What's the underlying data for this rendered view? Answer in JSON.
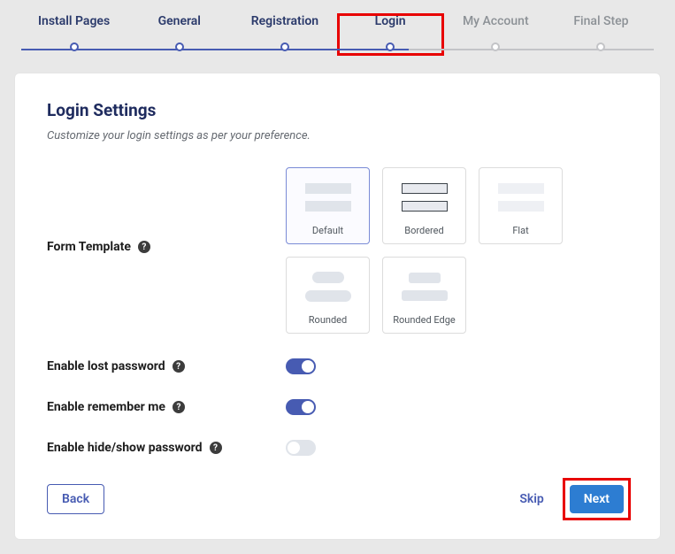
{
  "steps": {
    "install": "Install Pages",
    "general": "General",
    "registration": "Registration",
    "login": "Login",
    "account": "My Account",
    "final": "Final Step"
  },
  "heading": "Login Settings",
  "subheading": "Customize your login settings as per your preference.",
  "labels": {
    "form_template": "Form Template",
    "lost_password": "Enable lost password",
    "remember_me": "Enable remember me",
    "hide_show": "Enable hide/show password"
  },
  "templates": {
    "default": "Default",
    "bordered": "Bordered",
    "flat": "Flat",
    "rounded": "Rounded",
    "rounded_edge": "Rounded Edge"
  },
  "toggles": {
    "lost_password": true,
    "remember_me": true,
    "hide_show": false
  },
  "buttons": {
    "back": "Back",
    "skip": "Skip",
    "next": "Next"
  },
  "help_glyph": "?"
}
